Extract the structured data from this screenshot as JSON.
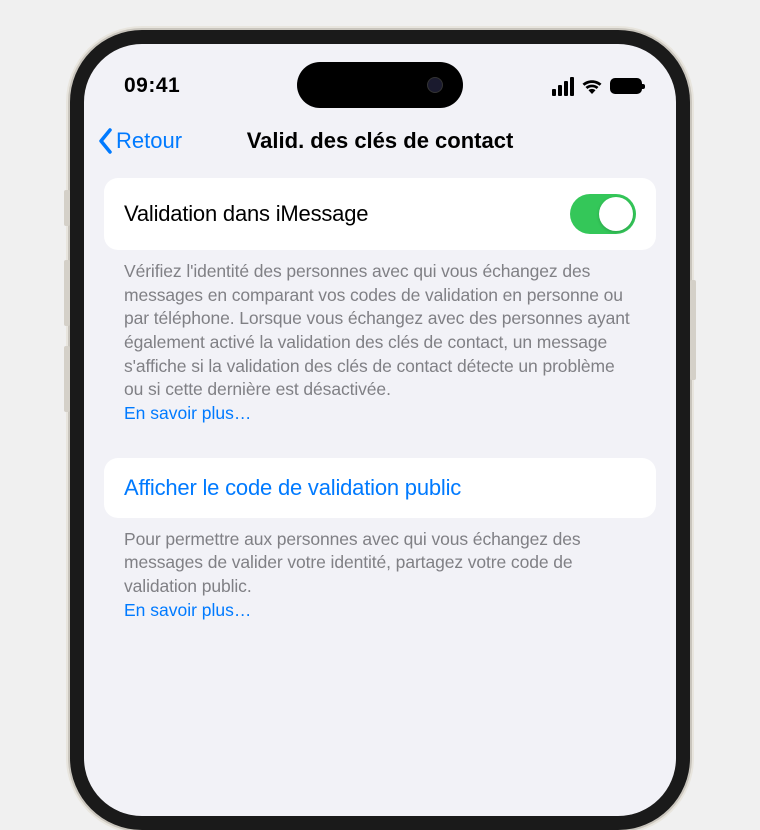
{
  "status_bar": {
    "time": "09:41"
  },
  "nav": {
    "back_label": "Retour",
    "title": "Valid. des clés de contact"
  },
  "section_validation": {
    "toggle_label": "Validation dans iMessage",
    "toggle_on": true,
    "description": "Vérifiez l'identité des personnes avec qui vous échangez des messages en comparant vos codes de validation en personne ou par téléphone. Lorsque vous échangez avec des personnes ayant également activé la validation des clés de contact, un message s'affiche si la validation des clés de contact détecte un problème ou si cette dernière est désactivée.",
    "learn_more": "En savoir plus…"
  },
  "section_public_code": {
    "link_label": "Afficher le code de validation public",
    "description": "Pour permettre aux personnes avec qui vous échangez des messages de valider votre identité, partagez votre code de validation public.",
    "learn_more": "En savoir plus…"
  },
  "colors": {
    "accent": "#007aff",
    "toggle_on": "#34c759",
    "bg": "#f2f2f7"
  }
}
